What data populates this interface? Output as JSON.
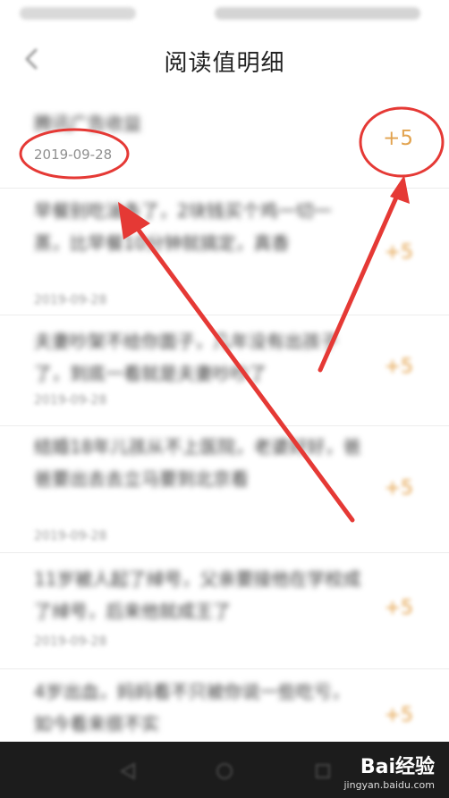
{
  "header": {
    "title": "阅读值明细"
  },
  "entries": [
    {
      "title": "腾讯广告收益",
      "date": "2019-09-28",
      "points": "+5"
    },
    {
      "title": "早餐别吃油条了，2块钱买个鸡一切一蒸，比早餐10分钟就搞定，真香",
      "date": "2019-09-28",
      "points": "+5"
    },
    {
      "title": "夫妻吵架不给你面子，几年没有出孩子了，到底一看就是夫妻吵吵了",
      "date": "2019-09-28",
      "points": "+5"
    },
    {
      "title": "结婚18年儿孩从不上医院，老婆好好，爸爸要出去去立马要到北京看",
      "date": "2019-09-28",
      "points": "+5"
    },
    {
      "title": "11岁被人起了绰号，父亲要接他在学校成了绰号，后来他就成王了",
      "date": "2019-09-28",
      "points": "+5"
    },
    {
      "title": "4岁出血，妈妈看不只被你说一些吃亏，如今看来很不实",
      "date": "2019-09-28",
      "points": "+5"
    }
  ],
  "watermark": {
    "brand": "Bai经验",
    "site": "jingyan.baidu.com"
  },
  "colors": {
    "accent": "#e3a14a",
    "annotation": "#e53935",
    "nav_bar": "#1c1c1c"
  },
  "icons": {
    "back": "chevron-left-icon",
    "nav_back": "triangle-back-icon",
    "nav_home": "circle-home-icon",
    "nav_recent": "square-recent-icon",
    "watermark_paw": "paw-icon"
  }
}
